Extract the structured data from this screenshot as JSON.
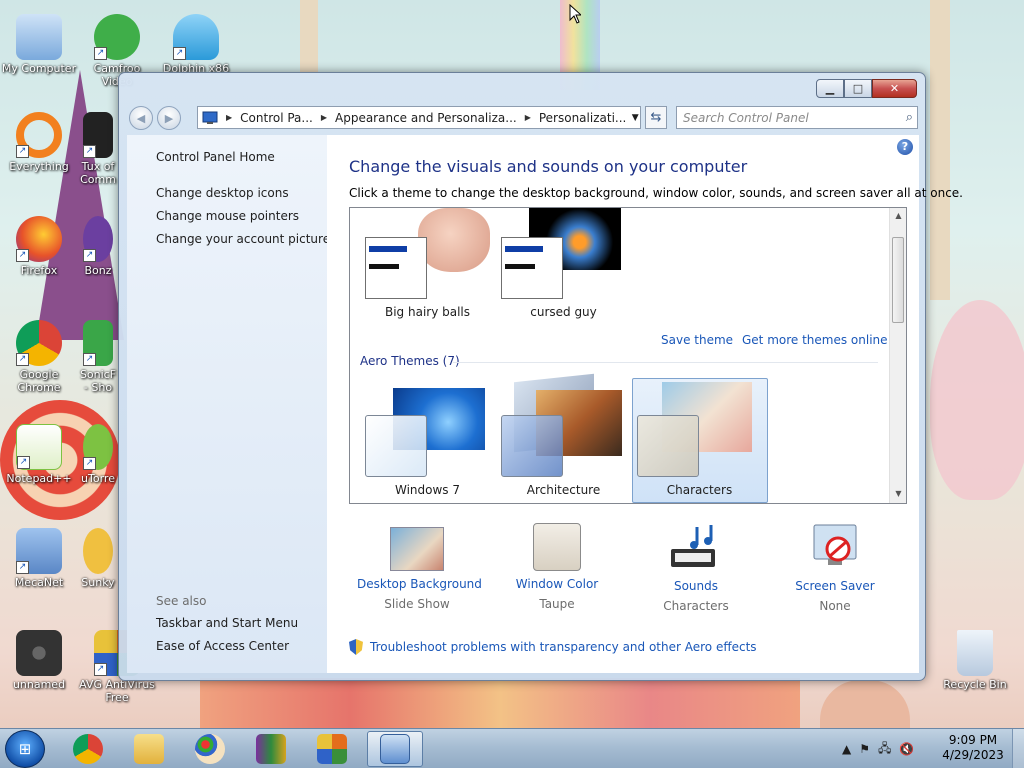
{
  "desktop": {
    "icons": [
      {
        "label": "My Computer",
        "color": "#7aa9dc"
      },
      {
        "label": "Camfroo Video",
        "color": "#3fae49"
      },
      {
        "label": "Dolphin x86",
        "color": "#2b9ad9"
      },
      {
        "label": "Everything",
        "color": "#f2801e"
      },
      {
        "label": "Tux of Comm",
        "color": "#222222"
      },
      {
        "label": "Firefox",
        "color": "#e7522a"
      },
      {
        "label": "Bonz",
        "color": "#6b3fa0"
      },
      {
        "label": "Google Chrome",
        "color": "#2a7be4"
      },
      {
        "label": "SonicF - Sho",
        "color": "#3aa648"
      },
      {
        "label": "Notepad++",
        "color": "#7dc242"
      },
      {
        "label": "uTorre",
        "color": "#7dc242"
      },
      {
        "label": "MecaNet",
        "color": "#5a87c6"
      },
      {
        "label": "Sunky",
        "color": "#f0c040"
      },
      {
        "label": "unnamed",
        "color": "#333333"
      },
      {
        "label": "AVG AntiVirus Free",
        "color": "#e36d1c"
      },
      {
        "label": "Recycle Bin",
        "color": "#cfdceb"
      }
    ]
  },
  "window": {
    "address": {
      "segments": [
        "Control Pa...",
        "Appearance and Personaliza...",
        "Personalizati..."
      ]
    },
    "search_placeholder": "Search Control Panel",
    "left_pane": {
      "home": "Control Panel Home",
      "links": [
        "Change desktop icons",
        "Change mouse pointers",
        "Change your account picture"
      ],
      "see_also_label": "See also",
      "see_also": [
        "Taskbar and Start Menu",
        "Ease of Access Center"
      ]
    },
    "main": {
      "heading": "Change the visuals and sounds on your computer",
      "subheading": "Click a theme to change the desktop background, window color, sounds, and screen saver all at once.",
      "my_themes": [
        "Big hairy balls",
        "cursed guy"
      ],
      "save_theme": "Save theme",
      "get_more": "Get more themes online",
      "aero_header": "Aero Themes (7)",
      "aero_themes": [
        "Windows 7",
        "Architecture",
        "Characters"
      ],
      "selected_theme": "Characters",
      "options": [
        {
          "title": "Desktop Background",
          "value": "Slide Show",
          "icon": "desktop-background-icon"
        },
        {
          "title": "Window Color",
          "value": "Taupe",
          "icon": "window-color-icon"
        },
        {
          "title": "Sounds",
          "value": "Characters",
          "icon": "sounds-icon"
        },
        {
          "title": "Screen Saver",
          "value": "None",
          "icon": "screen-saver-icon"
        }
      ],
      "troubleshoot": "Troubleshoot problems with transparency and other Aero effects"
    }
  },
  "taskbar": {
    "apps": [
      "internet-explorer",
      "chrome",
      "explorer",
      "paint",
      "winrar",
      "avg",
      "control-panel"
    ],
    "clock_time": "9:09 PM",
    "clock_date": "4/29/2023"
  },
  "colors": {
    "accent": "#1a57b8",
    "heading": "#1e3287",
    "window_color": "#e4ded2"
  }
}
